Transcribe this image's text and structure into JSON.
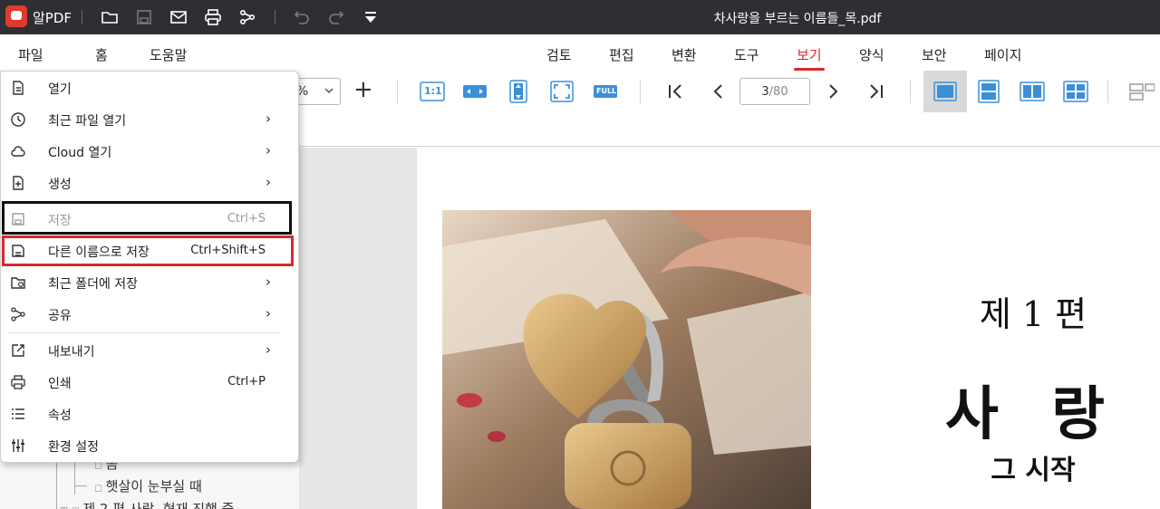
{
  "titlebar": {
    "app_name": "알PDF",
    "document_title": "차사랑을 부르는 이름들_목.pdf",
    "icons": [
      "app-logo-icon",
      "open-folder-icon",
      "save-icon",
      "mail-icon",
      "print-icon",
      "share-icon",
      "undo-icon",
      "redo-icon",
      "quick-menu-icon"
    ]
  },
  "menubar": {
    "items": [
      {
        "label": "파일"
      },
      {
        "label": "홈"
      },
      {
        "label": "도움말"
      },
      {
        "label": "검토"
      },
      {
        "label": "편집"
      },
      {
        "label": "변환"
      },
      {
        "label": "도구"
      },
      {
        "label": "보기",
        "active": true
      },
      {
        "label": "양식"
      },
      {
        "label": "보안"
      },
      {
        "label": "페이지"
      }
    ]
  },
  "toolbar": {
    "zoom_value": "%",
    "zoom_in_label": "+",
    "fit_labels": [
      "1:1",
      "FULL"
    ],
    "page_current": "3",
    "page_total": "/80"
  },
  "file_menu": {
    "items": [
      {
        "label": "열기",
        "icon": "open-file-icon",
        "shortcut": "",
        "submenu": false,
        "disabled": false
      },
      {
        "label": "최근 파일 열기",
        "icon": "clock-icon",
        "shortcut": "",
        "submenu": true,
        "disabled": false
      },
      {
        "label": "Cloud 열기",
        "icon": "cloud-icon",
        "shortcut": "",
        "submenu": true,
        "disabled": false
      },
      {
        "label": "생성",
        "icon": "create-file-icon",
        "shortcut": "",
        "submenu": true,
        "disabled": false
      },
      {
        "label": "저장",
        "icon": "save-icon",
        "shortcut": "Ctrl+S",
        "submenu": false,
        "disabled": true
      },
      {
        "label": "다른 이름으로 저장",
        "icon": "save-as-icon",
        "shortcut": "Ctrl+Shift+S",
        "submenu": false,
        "disabled": false
      },
      {
        "label": "최근 폴더에 저장",
        "icon": "folder-save-icon",
        "shortcut": "",
        "submenu": true,
        "disabled": false
      },
      {
        "label": "공유",
        "icon": "share-icon",
        "shortcut": "",
        "submenu": true,
        "disabled": false
      },
      {
        "label": "내보내기",
        "icon": "export-icon",
        "shortcut": "",
        "submenu": true,
        "disabled": false
      },
      {
        "label": "인쇄",
        "icon": "print-icon",
        "shortcut": "Ctrl+P",
        "submenu": false,
        "disabled": false
      },
      {
        "label": "속성",
        "icon": "list-icon",
        "shortcut": "",
        "submenu": false,
        "disabled": false
      },
      {
        "label": "환경 설정",
        "icon": "sliders-icon",
        "shortcut": "",
        "submenu": false,
        "disabled": false
      }
    ],
    "arrow_glyph": "›"
  },
  "sidebar": {
    "tree_items": [
      "봄",
      "햇살이 눈부실 때",
      "제 2 편 사랑, 현재 진행 중"
    ]
  },
  "document": {
    "heading_part": "제 1 편",
    "heading_title": "사 랑",
    "heading_sub": "그 시작"
  },
  "colors": {
    "accent": "#d9282f",
    "titlebar_bg": "#2f2f33",
    "toolbar_blue": "#3b8fd9"
  }
}
